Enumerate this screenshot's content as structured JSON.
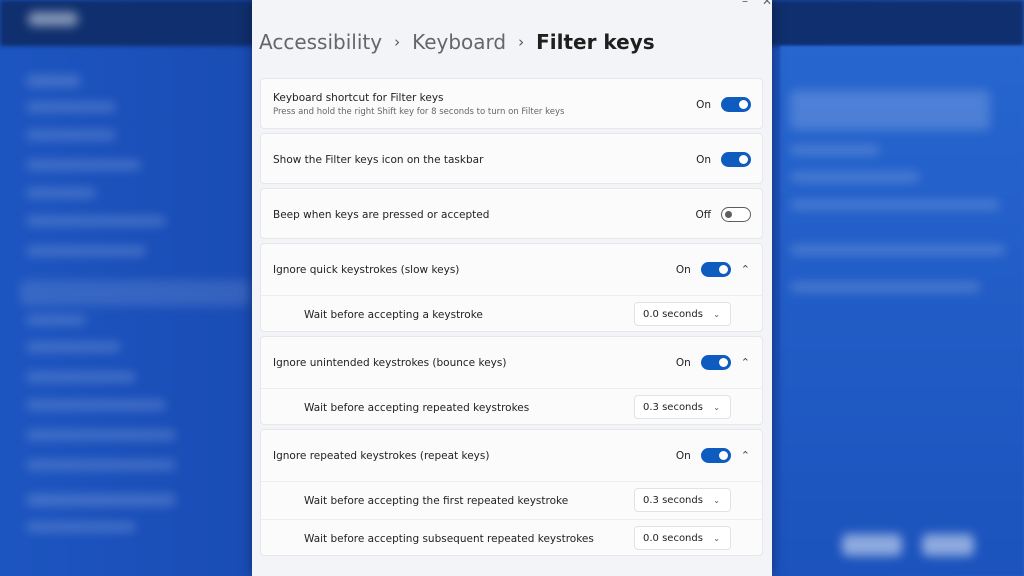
{
  "window_controls": {
    "minimize": "–",
    "close": "✕"
  },
  "breadcrumb": {
    "items": [
      "Accessibility",
      "Keyboard",
      "Filter keys"
    ],
    "separator": "›"
  },
  "settings": {
    "shortcut": {
      "label": "Keyboard shortcut for Filter keys",
      "description": "Press and hold the right Shift key for 8 seconds to turn on Filter keys",
      "state": "On"
    },
    "taskbar_icon": {
      "label": "Show the Filter keys icon on the taskbar",
      "state": "On"
    },
    "beep": {
      "label": "Beep when keys are pressed or accepted",
      "state": "Off"
    },
    "slow_keys": {
      "label": "Ignore quick keystrokes (slow keys)",
      "state": "On",
      "wait_label": "Wait before accepting a keystroke",
      "wait_value": "0.0 seconds"
    },
    "bounce_keys": {
      "label": "Ignore unintended keystrokes (bounce keys)",
      "state": "On",
      "wait_label": "Wait before accepting repeated keystrokes",
      "wait_value": "0.3 seconds"
    },
    "repeat_keys": {
      "label": "Ignore repeated keystrokes (repeat keys)",
      "state": "On",
      "first_label": "Wait before accepting the first repeated keystroke",
      "first_value": "0.3 seconds",
      "subsequent_label": "Wait before accepting subsequent repeated keystrokes",
      "subsequent_value": "0.0 seconds"
    }
  },
  "icons": {
    "expand_chevron": "chevron-up-icon",
    "dropdown_chevron": "chevron-down-icon"
  },
  "colors": {
    "accent": "#0f5cc0",
    "window_bg": "#f3f4f7",
    "card_bg": "#fbfbfc",
    "background": "#1a4fb8"
  }
}
